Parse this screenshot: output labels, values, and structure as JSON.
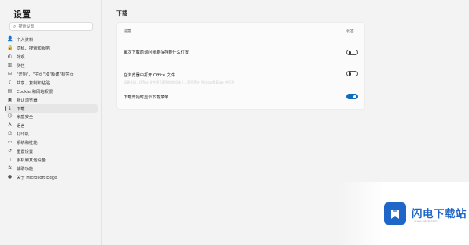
{
  "sidebar": {
    "title": "设置",
    "search_placeholder": "搜索设置",
    "items": [
      {
        "icon": "person-icon",
        "glyph": "👤",
        "label": "个人资料"
      },
      {
        "icon": "privacy-lock-icon",
        "glyph": "🔒",
        "label": "隐私、搜索和服务"
      },
      {
        "icon": "appearance-icon",
        "glyph": "◐",
        "label": "外观"
      },
      {
        "icon": "sidebar-icon",
        "glyph": "▥",
        "label": "侧栏"
      },
      {
        "icon": "start-page-icon",
        "glyph": "⊟",
        "label": "\"开始\"、\"主页\"和\"新建\"标签页"
      },
      {
        "icon": "share-copy-paste-icon",
        "glyph": "⇪",
        "label": "共享、复制和粘贴"
      },
      {
        "icon": "cookies-site-permissions-icon",
        "glyph": "▤",
        "label": "Cookie 和网站权限"
      },
      {
        "icon": "default-browser-icon",
        "glyph": "▣",
        "label": "默认浏览器"
      },
      {
        "icon": "download-icon",
        "glyph": "↓",
        "label": "下载"
      },
      {
        "icon": "family-safety-icon",
        "glyph": "☺",
        "label": "家庭安全"
      },
      {
        "icon": "languages-icon",
        "glyph": "A",
        "label": "语言"
      },
      {
        "icon": "printer-icon",
        "glyph": "⎙",
        "label": "打印机"
      },
      {
        "icon": "system-performance-icon",
        "glyph": "▭",
        "label": "系统和性能"
      },
      {
        "icon": "reset-settings-icon",
        "glyph": "↺",
        "label": "重置设置"
      },
      {
        "icon": "phone-devices-icon",
        "glyph": "▯",
        "label": "手机和其他设备"
      },
      {
        "icon": "accessibility-icon",
        "glyph": "✲",
        "label": "辅助功能"
      },
      {
        "icon": "edge-logo-icon",
        "glyph": "●",
        "label": "关于 Microsoft Edge"
      }
    ],
    "active_index": 8
  },
  "main": {
    "title": "下载",
    "card": {
      "col_left": "设置",
      "col_right": "状态",
      "rows": [
        {
          "title": "每次下载前询问我要保存到什么位置",
          "desc": "",
          "toggle": "off"
        },
        {
          "title": "在浏览器中打开 Office 文件",
          "desc": "如果关闭，Office 文件将下载到你的设备上，而不是在 Microsoft Edge 中打开",
          "toggle": "off"
        },
        {
          "title": "下载开始时显示下载菜单",
          "desc": "",
          "toggle": "on"
        }
      ]
    }
  },
  "watermark": {
    "text": "闪电下载站",
    "url": "www.sdxz.com"
  },
  "colors": {
    "accent": "#0f6cbd",
    "watermark_blue": "#1e66c8"
  }
}
